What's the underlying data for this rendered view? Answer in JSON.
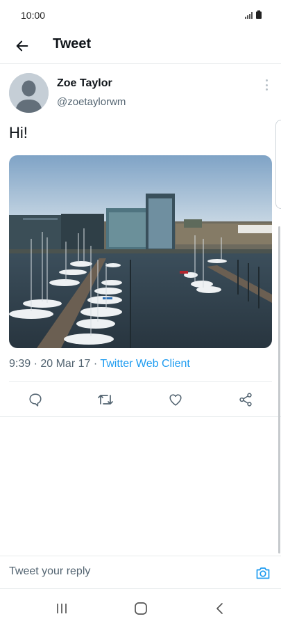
{
  "status_bar": {
    "time": "10:00"
  },
  "header": {
    "title": "Tweet"
  },
  "tweet": {
    "author_name": "Zoe Taylor",
    "author_handle": "@zoetaylorwm",
    "text": "Hi!",
    "time": "9:39",
    "date": "20 Mar 17",
    "separator": " · ",
    "client": "Twitter Web Client"
  },
  "reply": {
    "placeholder": "Tweet your reply"
  },
  "colors": {
    "accent": "#1d9bf0",
    "secondary_text": "#536471",
    "divider": "#e8ebed"
  },
  "icons": {
    "back": "arrow-left-icon",
    "more": "more-vertical-icon",
    "reply": "comment-icon",
    "retweet": "retweet-icon",
    "like": "heart-icon",
    "share": "share-icon",
    "camera": "camera-icon",
    "nav_recents": "recents-icon",
    "nav_home": "home-icon",
    "nav_back": "nav-back-icon"
  }
}
